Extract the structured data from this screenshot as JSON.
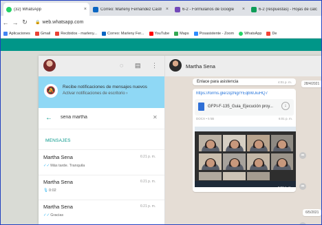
{
  "browser": {
    "tabs": [
      {
        "label": "(32) WhatsApp",
        "color": "#25d366",
        "active": true
      },
      {
        "label": "Correo: Marleny Fernández Castr",
        "color": "#0a66c2"
      },
      {
        "label": "6-2 - Formularios de Google",
        "color": "#7248b9"
      },
      {
        "label": "6-2 (respuestas) - Hojas de cálc",
        "color": "#0f9d58"
      }
    ],
    "close_glyph": "×",
    "url": "web.whatsapp.com",
    "bookmarks": [
      {
        "label": "Aplicaciones",
        "color": "#4285f4"
      },
      {
        "label": "Gmail",
        "color": "#ea4335"
      },
      {
        "label": "Recibidos - marleny...",
        "color": "#ea4335"
      },
      {
        "label": "Correo: Marleny Fer...",
        "color": "#0a66c2"
      },
      {
        "label": "YouTube",
        "color": "#ff0000"
      },
      {
        "label": "Maps",
        "color": "#34a853"
      },
      {
        "label": "Posasistente - Zoom",
        "color": "#2d8cff"
      },
      {
        "label": "WhatsApp",
        "color": "#25d366"
      },
      {
        "label": "De",
        "color": "#f44336"
      }
    ]
  },
  "sidebar": {
    "notification": {
      "title": "Recibe notificaciones de mensajes nuevos",
      "subtitle": "Activar notificaciones de escritorio ›"
    },
    "search_value": "sena martha",
    "section_label": "MENSAJES",
    "results": [
      {
        "name": "Martha Sena",
        "time": "6:21 p. m.",
        "preview": "Más tarde. Tranquila",
        "icon": "double-check-icon"
      },
      {
        "name": "Martha Sena",
        "time": "6:21 p. m.",
        "preview": "0:02",
        "icon": "mic-icon"
      },
      {
        "name": "Martha Sena",
        "time": "6:21 p. m.",
        "preview": "Gracias",
        "icon": "double-check-icon"
      }
    ]
  },
  "chat": {
    "contact_name": "Martha Sena",
    "messages": {
      "link_title": "Enlace para asistencia",
      "link_time": "4:01 p. m.",
      "link_url": "https://forms.gle/2qzNgrYEqbWJiuHQ7",
      "doc_name": "GFPI-F-135_Guia_Ejecución proy...",
      "doc_meta": "DOCX • 5 kB",
      "doc_time": "6:01 p. m.",
      "video_time": "5:59 p. m."
    },
    "date_chips": [
      "28/4/2021",
      "6/5/2021"
    ]
  },
  "colors": {
    "teal": "#009688",
    "notif_bg": "#8fd8f5",
    "chat_bg": "#e5ddd5",
    "link": "#1e6fd9"
  }
}
